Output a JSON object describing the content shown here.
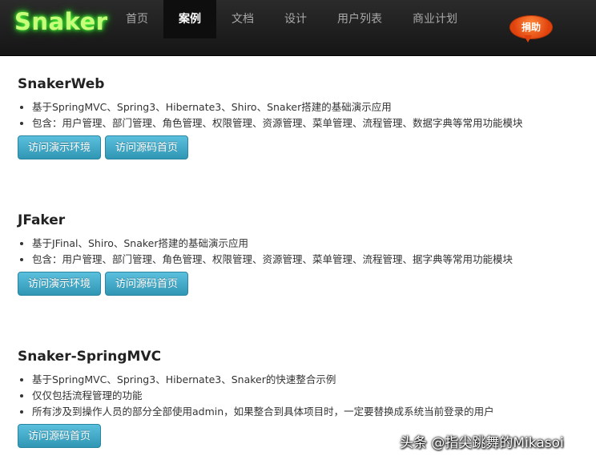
{
  "header": {
    "logo": "Snaker",
    "nav": [
      "首页",
      "案例",
      "文档",
      "设计",
      "用户列表",
      "商业计划"
    ],
    "active_index": 1,
    "donate": "捐助"
  },
  "projects": [
    {
      "title": "SnakerWeb",
      "items": [
        "基于SpringMVC、Spring3、Hibernate3、Shiro、Snaker搭建的基础演示应用",
        "包含：用户管理、部门管理、角色管理、权限管理、资源管理、菜单管理、流程管理、数据字典等常用功能模块"
      ],
      "buttons": [
        "访问演示环境",
        "访问源码首页"
      ]
    },
    {
      "title": "JFaker",
      "items": [
        "基于JFinal、Shiro、Snaker搭建的基础演示应用",
        "包含：用户管理、部门管理、角色管理、权限管理、资源管理、菜单管理、流程管理、据字典等常用功能模块"
      ],
      "buttons": [
        "访问演示环境",
        "访问源码首页"
      ]
    },
    {
      "title": "Snaker-SpringMVC",
      "items": [
        "基于SpringMVC、Spring3、Hibernate3、Snaker的快速整合示例",
        "仅仅包括流程管理的功能",
        "所有涉及到操作人员的部分全部使用admin，如果整合到具体项目时，一定要替换成系统当前登录的用户"
      ],
      "buttons": [
        "访问源码首页"
      ]
    }
  ],
  "watermark": "头条 @指尖跳舞的Mikasoi"
}
